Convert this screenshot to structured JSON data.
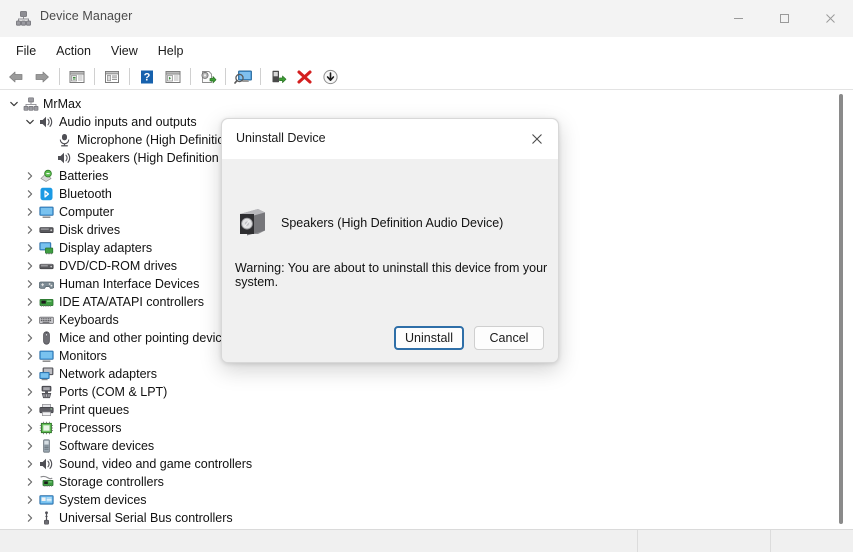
{
  "window": {
    "title": "Device Manager",
    "icon": "device-manager-icon",
    "caption": {
      "minimize": "minimize-icon",
      "maximize": "maximize-icon",
      "close": "close-icon"
    }
  },
  "menubar": {
    "items": [
      {
        "label": "File"
      },
      {
        "label": "Action"
      },
      {
        "label": "View"
      },
      {
        "label": "Help"
      }
    ]
  },
  "toolbar": {
    "buttons": [
      {
        "name": "back-arrow-icon",
        "tooltip": "Back"
      },
      {
        "name": "forward-arrow-icon",
        "tooltip": "Forward"
      },
      {
        "name": "separator-1",
        "tooltip": ""
      },
      {
        "name": "show-hide-console-tree-icon",
        "tooltip": "Show/Hide Console Tree"
      },
      {
        "name": "separator-2",
        "tooltip": ""
      },
      {
        "name": "properties-icon",
        "tooltip": "Properties"
      },
      {
        "name": "separator-3",
        "tooltip": ""
      },
      {
        "name": "help-icon",
        "tooltip": "Help"
      },
      {
        "name": "show-hide-action-pane-icon",
        "tooltip": "Show/Hide Action Pane"
      },
      {
        "name": "separator-4",
        "tooltip": ""
      },
      {
        "name": "update-driver-icon",
        "tooltip": "Update driver"
      },
      {
        "name": "separator-5",
        "tooltip": ""
      },
      {
        "name": "scan-for-hardware-changes-icon",
        "tooltip": "Scan for hardware changes"
      },
      {
        "name": "separator-6",
        "tooltip": ""
      },
      {
        "name": "enable-device-icon",
        "tooltip": "Enable device"
      },
      {
        "name": "uninstall-device-icon",
        "tooltip": "Uninstall device"
      },
      {
        "name": "disable-device-icon",
        "tooltip": "Disable device"
      }
    ]
  },
  "tree": {
    "nodes": [
      {
        "label": "MrMax",
        "indent": 0,
        "twisty": "expanded",
        "icon": "computer-root-icon"
      },
      {
        "label": "Audio inputs and outputs",
        "indent": 1,
        "twisty": "expanded",
        "icon": "speaker-icon"
      },
      {
        "label": "Microphone (High Definition Audio Device)",
        "indent": 2,
        "twisty": "none",
        "icon": "microphone-icon"
      },
      {
        "label": "Speakers (High Definition Audio Device)",
        "indent": 2,
        "twisty": "none",
        "icon": "speaker-icon"
      },
      {
        "label": "Batteries",
        "indent": 1,
        "twisty": "collapsed",
        "icon": "battery-icon"
      },
      {
        "label": "Bluetooth",
        "indent": 1,
        "twisty": "collapsed",
        "icon": "bluetooth-icon"
      },
      {
        "label": "Computer",
        "indent": 1,
        "twisty": "collapsed",
        "icon": "monitor-icon"
      },
      {
        "label": "Disk drives",
        "indent": 1,
        "twisty": "collapsed",
        "icon": "disk-drive-icon"
      },
      {
        "label": "Display adapters",
        "indent": 1,
        "twisty": "collapsed",
        "icon": "display-adapter-icon"
      },
      {
        "label": "DVD/CD-ROM drives",
        "indent": 1,
        "twisty": "collapsed",
        "icon": "dvd-drive-icon"
      },
      {
        "label": "Human Interface Devices",
        "indent": 1,
        "twisty": "collapsed",
        "icon": "hid-icon"
      },
      {
        "label": "IDE ATA/ATAPI controllers",
        "indent": 1,
        "twisty": "collapsed",
        "icon": "ide-controller-icon"
      },
      {
        "label": "Keyboards",
        "indent": 1,
        "twisty": "collapsed",
        "icon": "keyboard-icon"
      },
      {
        "label": "Mice and other pointing devices",
        "indent": 1,
        "twisty": "collapsed",
        "icon": "mouse-icon"
      },
      {
        "label": "Monitors",
        "indent": 1,
        "twisty": "collapsed",
        "icon": "monitor-icon"
      },
      {
        "label": "Network adapters",
        "indent": 1,
        "twisty": "collapsed",
        "icon": "network-adapter-icon"
      },
      {
        "label": "Ports (COM & LPT)",
        "indent": 1,
        "twisty": "collapsed",
        "icon": "port-icon"
      },
      {
        "label": "Print queues",
        "indent": 1,
        "twisty": "collapsed",
        "icon": "printer-icon"
      },
      {
        "label": "Processors",
        "indent": 1,
        "twisty": "collapsed",
        "icon": "processor-icon"
      },
      {
        "label": "Software devices",
        "indent": 1,
        "twisty": "collapsed",
        "icon": "software-device-icon"
      },
      {
        "label": "Sound, video and game controllers",
        "indent": 1,
        "twisty": "collapsed",
        "icon": "speaker-icon"
      },
      {
        "label": "Storage controllers",
        "indent": 1,
        "twisty": "collapsed",
        "icon": "storage-controller-icon"
      },
      {
        "label": "System devices",
        "indent": 1,
        "twisty": "collapsed",
        "icon": "system-device-icon"
      },
      {
        "label": "Universal Serial Bus controllers",
        "indent": 1,
        "twisty": "collapsed",
        "icon": "usb-icon"
      }
    ]
  },
  "statusbar": {
    "pane1": "",
    "pane2": "",
    "pane3": ""
  },
  "dialog": {
    "title": "Uninstall Device",
    "close_icon": "close-icon",
    "device_icon": "speaker-device-icon",
    "device_name": "Speakers (High Definition Audio Device)",
    "warning": "Warning: You are about to uninstall this device from your system.",
    "buttons": {
      "confirm": "Uninstall",
      "cancel": "Cancel"
    }
  },
  "colors": {
    "accent": "#2f6fa8",
    "titlebar_bg": "#f3f3f3",
    "dialog_bg": "#f0f0f0",
    "statusbar_bg": "#f0f0f0",
    "danger": "#d41f1f",
    "bluetooth": "#1b9ae4",
    "green": "#3a9e2f"
  }
}
